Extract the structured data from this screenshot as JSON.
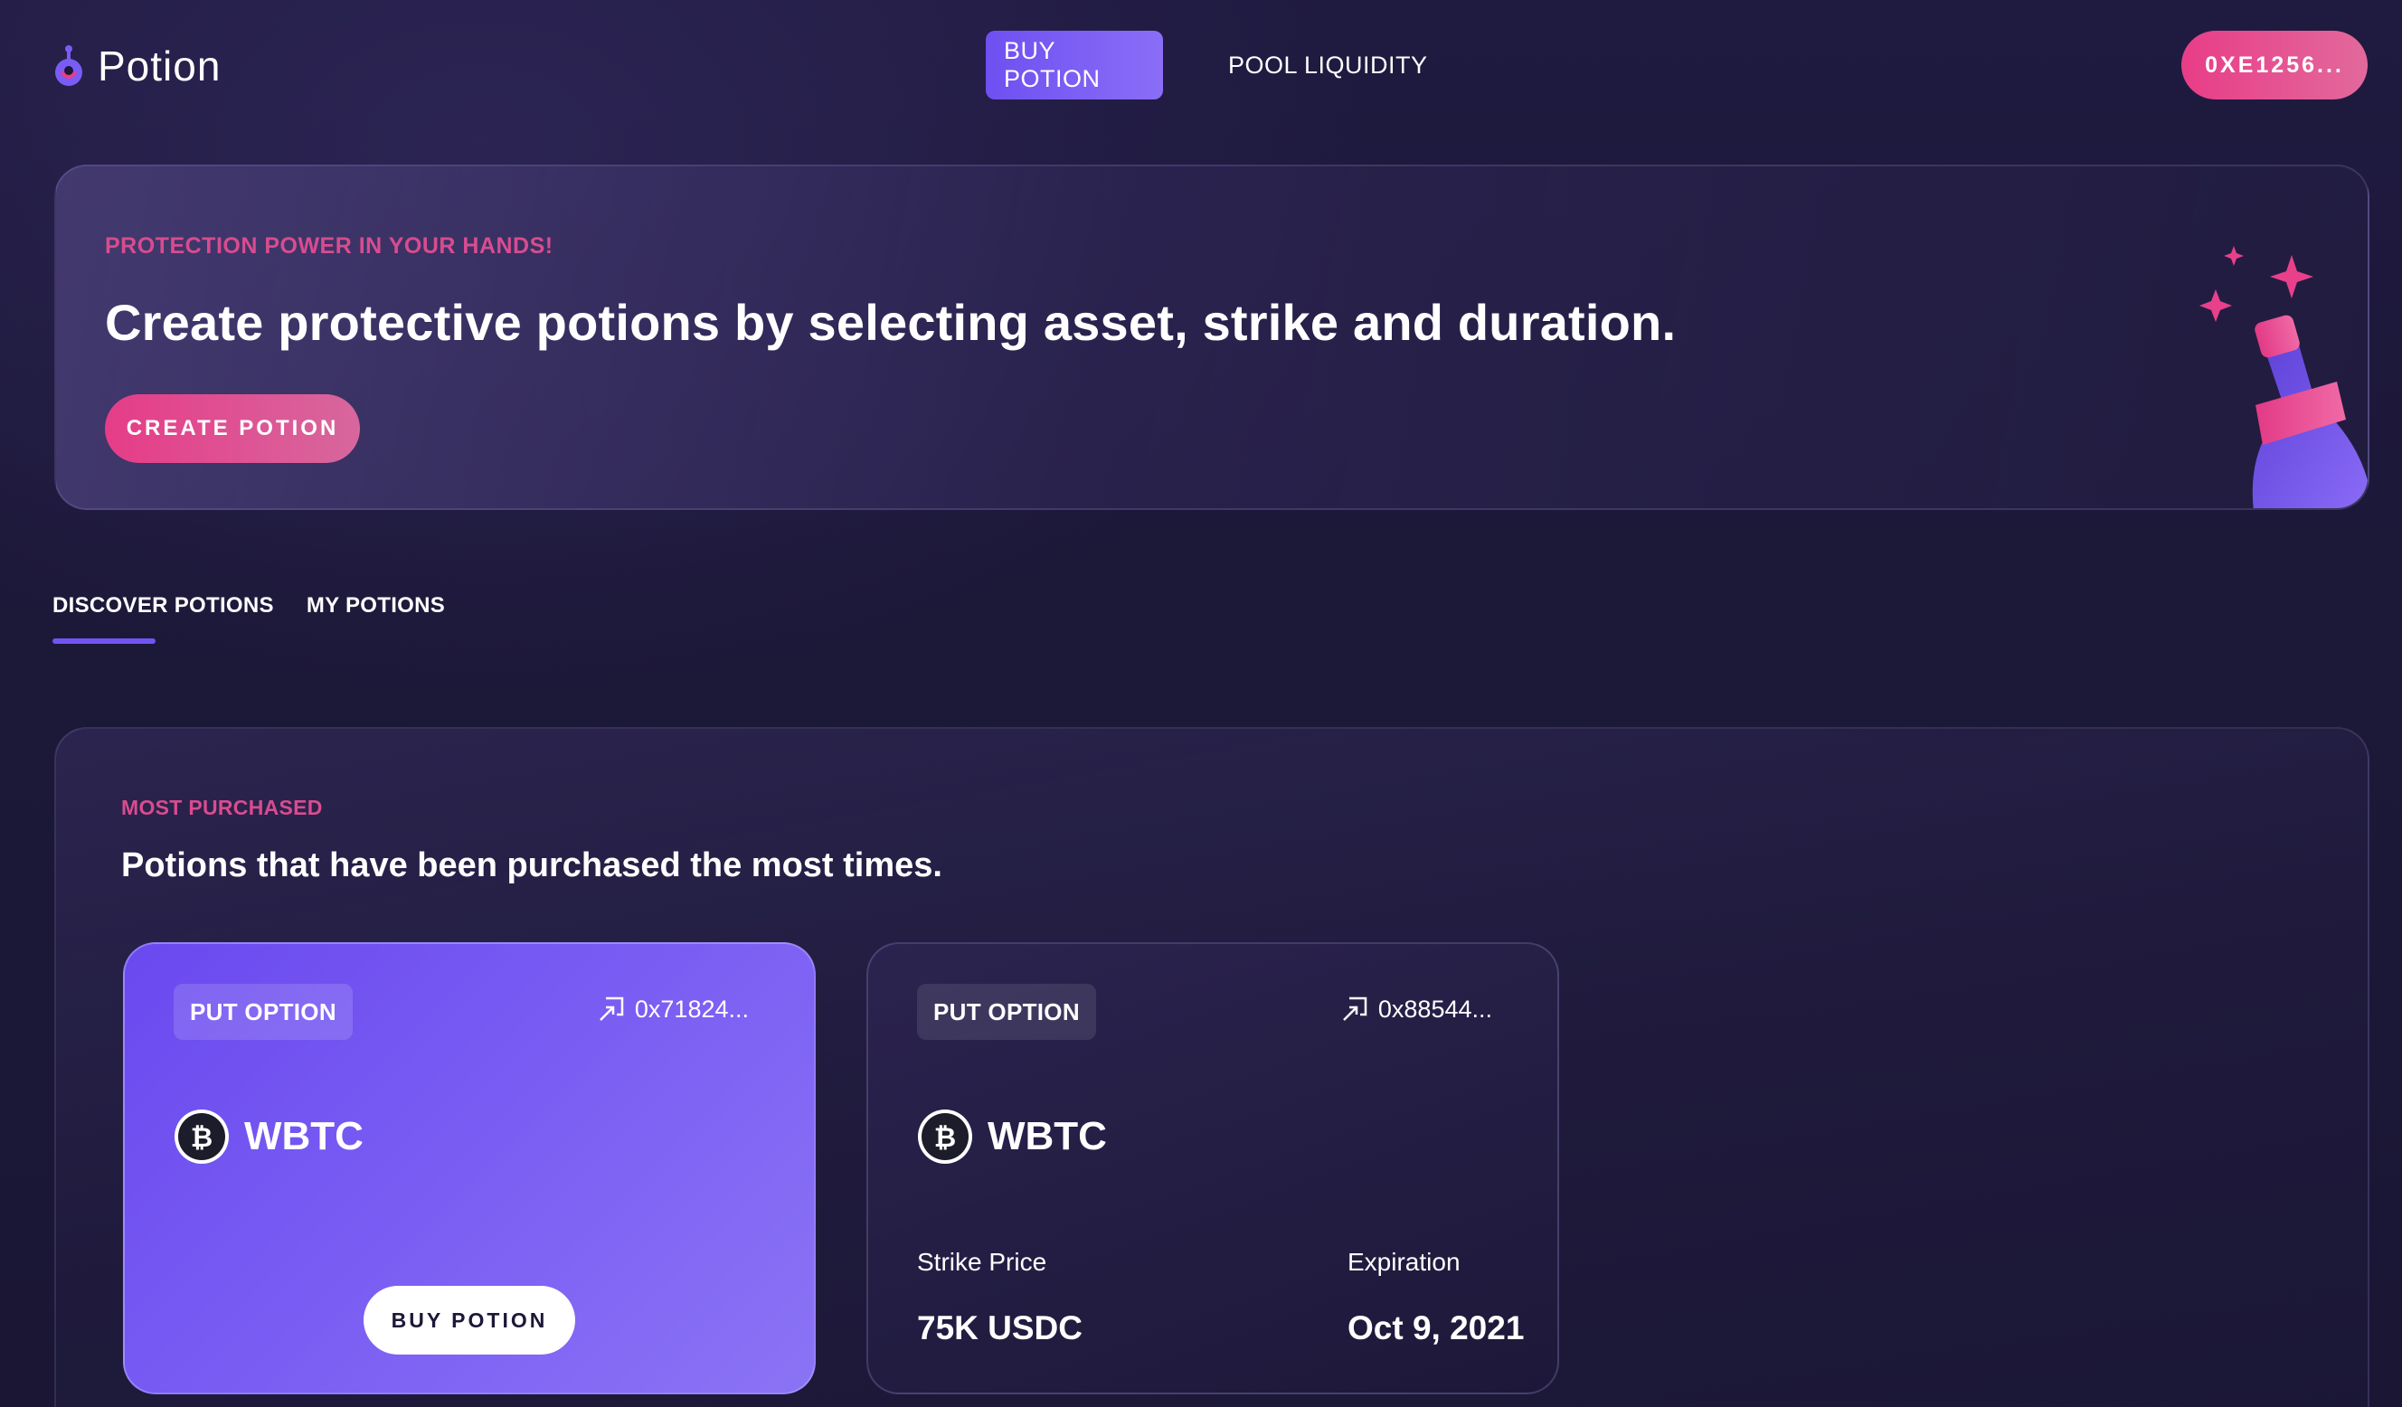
{
  "header": {
    "logo_text": "Potion",
    "nav": [
      {
        "label": "BUY POTION",
        "active": true
      },
      {
        "label": "POOL LIQUIDITY",
        "active": false
      }
    ],
    "wallet_address": "0XE1256..."
  },
  "hero": {
    "eyebrow": "PROTECTION POWER IN YOUR HANDS!",
    "title": "Create protective potions by selecting asset, strike and duration.",
    "cta_label": "CREATE POTION"
  },
  "tabs": [
    {
      "label": "DISCOVER POTIONS",
      "active": true
    },
    {
      "label": "MY POTIONS",
      "active": false
    }
  ],
  "section": {
    "eyebrow": "MOST PURCHASED",
    "title": "Potions that have been purchased the most times.",
    "cards": [
      {
        "type": "PUT OPTION",
        "address": "0x71824...",
        "asset": "WBTC",
        "buy_label": "BUY POTION"
      },
      {
        "type": "PUT OPTION",
        "address": "0x88544...",
        "asset": "WBTC",
        "strike_label": "Strike Price",
        "strike_value": "75K USDC",
        "expiration_label": "Expiration",
        "expiration_value": "Oct 9, 2021"
      }
    ]
  },
  "colors": {
    "background": "#1c1838",
    "accent_purple": "#6e50f1",
    "accent_pink": "#e63c88",
    "eyebrow_pink": "#d84c8f"
  }
}
